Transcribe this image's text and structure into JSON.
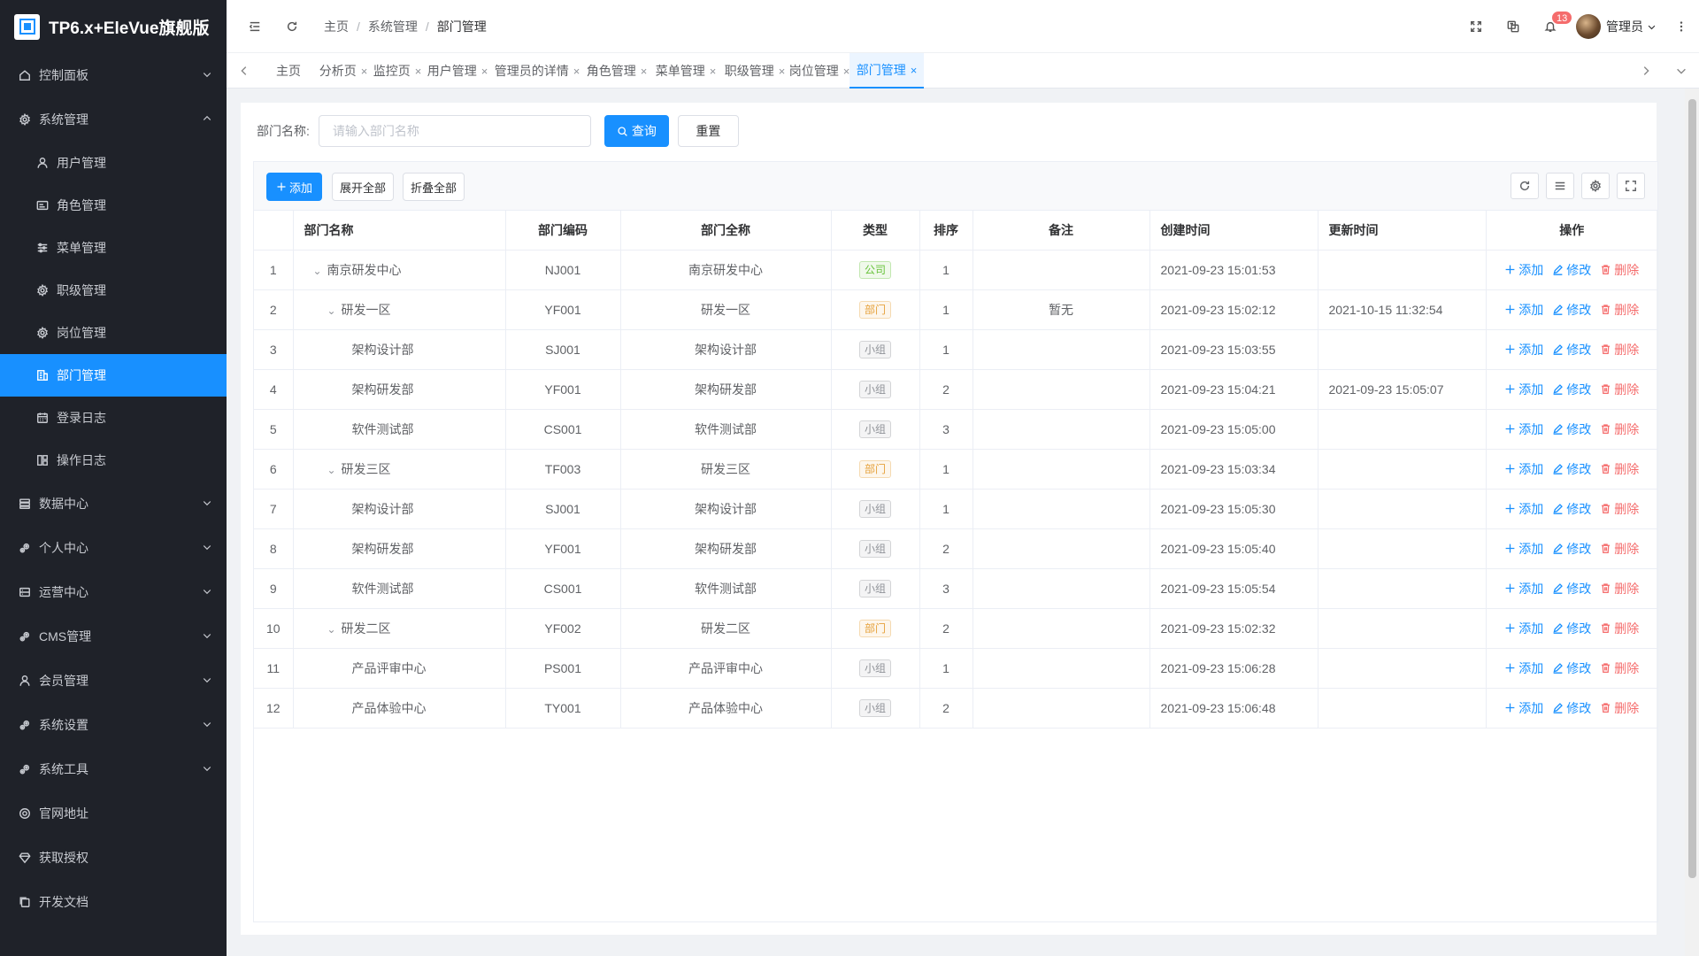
{
  "app": {
    "title": "TP6.x+EleVue旗舰版"
  },
  "sidebar": {
    "items": [
      {
        "label": "控制面板",
        "icon": "home-icon",
        "expandable": true
      },
      {
        "label": "系统管理",
        "icon": "gear-icon",
        "expandable": true,
        "expanded": true,
        "children": [
          {
            "label": "用户管理",
            "icon": "user-icon"
          },
          {
            "label": "角色管理",
            "icon": "id-card-icon"
          },
          {
            "label": "菜单管理",
            "icon": "sliders-icon"
          },
          {
            "label": "职级管理",
            "icon": "gear-icon"
          },
          {
            "label": "岗位管理",
            "icon": "gear-icon"
          },
          {
            "label": "部门管理",
            "icon": "org-icon",
            "active": true
          },
          {
            "label": "登录日志",
            "icon": "calendar-icon"
          },
          {
            "label": "操作日志",
            "icon": "log-icon"
          }
        ]
      },
      {
        "label": "数据中心",
        "icon": "database-icon",
        "expandable": true
      },
      {
        "label": "个人中心",
        "icon": "gears-icon",
        "expandable": true
      },
      {
        "label": "运营中心",
        "icon": "storage-icon",
        "expandable": true
      },
      {
        "label": "CMS管理",
        "icon": "gears-icon",
        "expandable": true
      },
      {
        "label": "会员管理",
        "icon": "user-icon",
        "expandable": true
      },
      {
        "label": "系统设置",
        "icon": "gears-icon",
        "expandable": true
      },
      {
        "label": "系统工具",
        "icon": "gears-icon",
        "expandable": true
      },
      {
        "label": "官网地址",
        "icon": "globe-icon"
      },
      {
        "label": "获取授权",
        "icon": "diamond-icon"
      },
      {
        "label": "开发文档",
        "icon": "copy-icon"
      }
    ]
  },
  "header": {
    "breadcrumb": [
      "主页",
      "系统管理",
      "部门管理"
    ],
    "notification_count": "13",
    "user_name": "管理员"
  },
  "tabs": [
    {
      "label": "主页",
      "closable": false
    },
    {
      "label": "分析页",
      "closable": true
    },
    {
      "label": "监控页",
      "closable": true
    },
    {
      "label": "用户管理",
      "closable": true
    },
    {
      "label": "管理员的详情",
      "closable": true
    },
    {
      "label": "角色管理",
      "closable": true
    },
    {
      "label": "菜单管理",
      "closable": true
    },
    {
      "label": "职级管理",
      "closable": true
    },
    {
      "label": "岗位管理",
      "closable": true
    },
    {
      "label": "部门管理",
      "closable": true,
      "active": true
    }
  ],
  "search": {
    "label": "部门名称:",
    "placeholder": "请输入部门名称",
    "query_label": "查询",
    "reset_label": "重置"
  },
  "toolbar": {
    "add_label": "添加",
    "expand_all_label": "展开全部",
    "collapse_all_label": "折叠全部"
  },
  "table": {
    "columns": [
      "",
      "部门名称",
      "部门编码",
      "部门全称",
      "类型",
      "排序",
      "备注",
      "创建时间",
      "更新时间",
      "操作"
    ],
    "actions": {
      "add": "添加",
      "edit": "修改",
      "delete": "删除"
    },
    "rows": [
      {
        "index": "1",
        "name": "南京研发中心",
        "level": 0,
        "toggle": true,
        "code": "NJ001",
        "full_name": "南京研发中心",
        "type": "公司",
        "type_kind": "company",
        "sort": "1",
        "remark": "",
        "created": "2021-09-23 15:01:53",
        "updated": ""
      },
      {
        "index": "2",
        "name": "研发一区",
        "level": 1,
        "toggle": true,
        "code": "YF001",
        "full_name": "研发一区",
        "type": "部门",
        "type_kind": "dept",
        "sort": "1",
        "remark": "暂无",
        "created": "2021-09-23 15:02:12",
        "updated": "2021-10-15 11:32:54"
      },
      {
        "index": "3",
        "name": "架构设计部",
        "level": 2,
        "toggle": false,
        "code": "SJ001",
        "full_name": "架构设计部",
        "type": "小组",
        "type_kind": "group",
        "sort": "1",
        "remark": "",
        "created": "2021-09-23 15:03:55",
        "updated": ""
      },
      {
        "index": "4",
        "name": "架构研发部",
        "level": 2,
        "toggle": false,
        "code": "YF001",
        "full_name": "架构研发部",
        "type": "小组",
        "type_kind": "group",
        "sort": "2",
        "remark": "",
        "created": "2021-09-23 15:04:21",
        "updated": "2021-09-23 15:05:07"
      },
      {
        "index": "5",
        "name": "软件测试部",
        "level": 2,
        "toggle": false,
        "code": "CS001",
        "full_name": "软件测试部",
        "type": "小组",
        "type_kind": "group",
        "sort": "3",
        "remark": "",
        "created": "2021-09-23 15:05:00",
        "updated": ""
      },
      {
        "index": "6",
        "name": "研发三区",
        "level": 1,
        "toggle": true,
        "code": "TF003",
        "full_name": "研发三区",
        "type": "部门",
        "type_kind": "dept",
        "sort": "1",
        "remark": "",
        "created": "2021-09-23 15:03:34",
        "updated": ""
      },
      {
        "index": "7",
        "name": "架构设计部",
        "level": 2,
        "toggle": false,
        "code": "SJ001",
        "full_name": "架构设计部",
        "type": "小组",
        "type_kind": "group",
        "sort": "1",
        "remark": "",
        "created": "2021-09-23 15:05:30",
        "updated": ""
      },
      {
        "index": "8",
        "name": "架构研发部",
        "level": 2,
        "toggle": false,
        "code": "YF001",
        "full_name": "架构研发部",
        "type": "小组",
        "type_kind": "group",
        "sort": "2",
        "remark": "",
        "created": "2021-09-23 15:05:40",
        "updated": ""
      },
      {
        "index": "9",
        "name": "软件测试部",
        "level": 2,
        "toggle": false,
        "code": "CS001",
        "full_name": "软件测试部",
        "type": "小组",
        "type_kind": "group",
        "sort": "3",
        "remark": "",
        "created": "2021-09-23 15:05:54",
        "updated": ""
      },
      {
        "index": "10",
        "name": "研发二区",
        "level": 1,
        "toggle": true,
        "code": "YF002",
        "full_name": "研发二区",
        "type": "部门",
        "type_kind": "dept",
        "sort": "2",
        "remark": "",
        "created": "2021-09-23 15:02:32",
        "updated": ""
      },
      {
        "index": "11",
        "name": "产品评审中心",
        "level": 2,
        "toggle": false,
        "code": "PS001",
        "full_name": "产品评审中心",
        "type": "小组",
        "type_kind": "group",
        "sort": "1",
        "remark": "",
        "created": "2021-09-23 15:06:28",
        "updated": ""
      },
      {
        "index": "12",
        "name": "产品体验中心",
        "level": 2,
        "toggle": false,
        "code": "TY001",
        "full_name": "产品体验中心",
        "type": "小组",
        "type_kind": "group",
        "sort": "2",
        "remark": "",
        "created": "2021-09-23 15:06:48",
        "updated": ""
      }
    ]
  },
  "colors": {
    "primary": "#1890ff",
    "sidebar_bg": "#1f2229",
    "danger": "#f56c6c",
    "success": "#67c23a",
    "warning": "#e6a23c"
  }
}
